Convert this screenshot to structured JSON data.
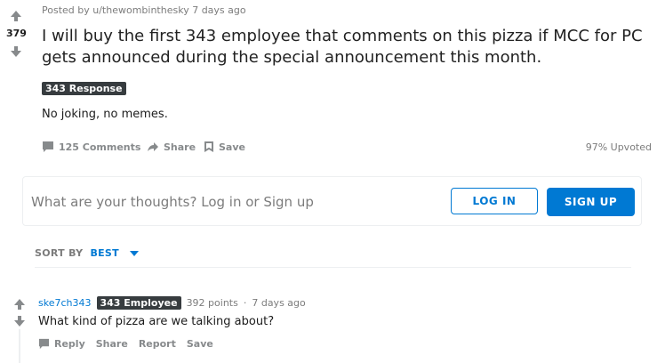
{
  "post": {
    "score": "379",
    "meta": "Posted by u/thewombinthesky 7 days ago",
    "title": "I will buy the first 343 employee that comments on this pizza if MCC for PC gets announced during the special announcement this month.",
    "flair": "343 Response",
    "body": "No joking, no memes.",
    "actions": {
      "comments": "125 Comments",
      "share": "Share",
      "save": "Save"
    },
    "upvoted": "97% Upvoted"
  },
  "comment_box": {
    "prompt": "What are your thoughts? Log in or Sign up",
    "login_label": "LOG IN",
    "signup_label": "SIGN UP"
  },
  "sort": {
    "label": "SORT BY",
    "value": "BEST"
  },
  "comment": {
    "user": "ske7ch343",
    "flair": "343 Employee",
    "points": "392 points",
    "separator": "·",
    "time": "7 days ago",
    "text": "What kind of pizza are we talking about?",
    "actions": [
      "Reply",
      "Share",
      "Report",
      "Save"
    ]
  },
  "colors": {
    "accent": "#0079d3",
    "flair_bg": "#373c3f",
    "muted": "#878a8c"
  }
}
